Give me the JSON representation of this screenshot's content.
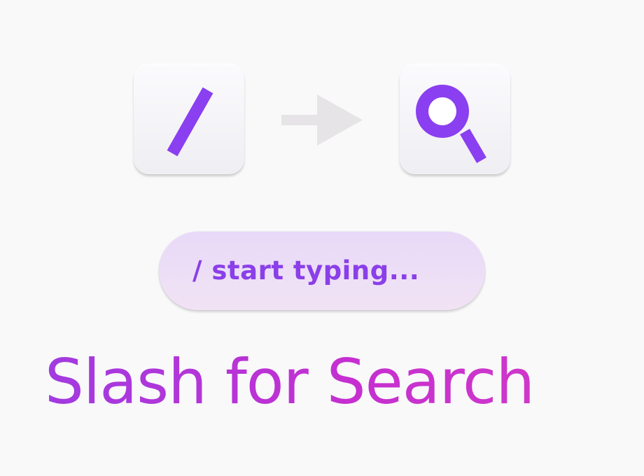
{
  "keys": {
    "slash_icon": "slash-icon",
    "search_icon": "magnifier-icon",
    "arrow_icon": "arrow-right-icon"
  },
  "search_pill": {
    "text": "/ start typing..."
  },
  "title": "Slash for Search",
  "colors": {
    "accent_purple": "#8a3ff0",
    "title_gradient_start": "#a13be0",
    "title_gradient_end": "#d23ac8",
    "pill_background": "#eadcf7",
    "arrow_gray": "#e6e4e6",
    "background": "#f9f9fa"
  }
}
